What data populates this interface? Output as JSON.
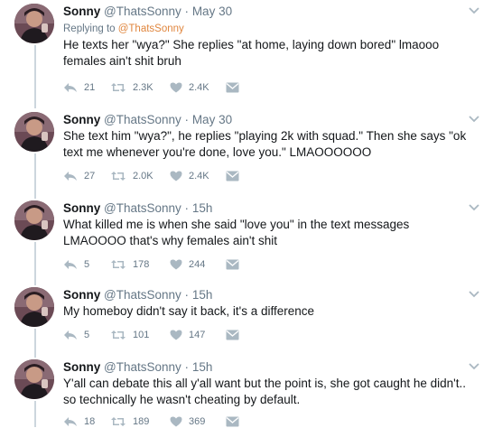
{
  "tweets": [
    {
      "name": "Sonny",
      "handle": "@ThatsSonny",
      "dot": "·",
      "time": "May 30",
      "reply_prefix": "Replying to ",
      "reply_handle": "@ThatsSonny",
      "text": "He texts her \"wya?\" She replies \"at home, laying down bored\" lmaooo females ain't shit bruh",
      "replies": "21",
      "retweets": "2.3K",
      "likes": "2.4K"
    },
    {
      "name": "Sonny",
      "handle": "@ThatsSonny",
      "dot": "·",
      "time": "May 30",
      "text": "She text him \"wya?\", he replies \"playing 2k with squad.\" Then she says \"ok text me whenever you're done, love you.\" LMAOOOOOO",
      "replies": "27",
      "retweets": "2.0K",
      "likes": "2.4K"
    },
    {
      "name": "Sonny",
      "handle": "@ThatsSonny",
      "dot": "·",
      "time": "15h",
      "text": "What killed me is when she said \"love you\" in the text messages LMAOOOO that's why females ain't shit",
      "replies": "5",
      "retweets": "178",
      "likes": "244"
    },
    {
      "name": "Sonny",
      "handle": "@ThatsSonny",
      "dot": "·",
      "time": "15h",
      "text": "My homeboy didn't say it back, it's a difference",
      "replies": "5",
      "retweets": "101",
      "likes": "147"
    },
    {
      "name": "Sonny",
      "handle": "@ThatsSonny",
      "dot": "·",
      "time": "15h",
      "text": "Y'all can debate this all y'all want but the point is, she got caught he didn't.. so technically he wasn't cheating by default.",
      "replies": "18",
      "retweets": "189",
      "likes": "369"
    }
  ],
  "colors": {
    "text": "#14171a",
    "muted": "#657786",
    "mention": "#e0863e",
    "thread_line": "#ccd6dd"
  },
  "icons": [
    "reply-icon",
    "retweet-icon",
    "like-icon",
    "direct-message-icon",
    "chevron-down-icon",
    "avatar"
  ]
}
